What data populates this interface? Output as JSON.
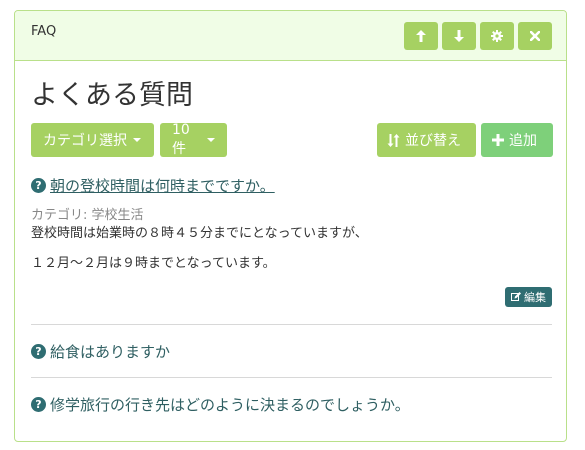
{
  "panel": {
    "title": "FAQ",
    "buttons": [
      {
        "icon": "arrow-up-icon"
      },
      {
        "icon": "arrow-down-icon"
      },
      {
        "icon": "gear-icon"
      },
      {
        "icon": "close-icon"
      }
    ]
  },
  "page_title": "よくある質問",
  "toolbar": {
    "category_select_label": "カテゴリ選択",
    "per_page_label": "10件",
    "sort_label": "並び替え",
    "add_label": "追加"
  },
  "faqs": [
    {
      "question": "朝の登校時間は何時までですか。",
      "expanded": true,
      "category_label": "カテゴリ: 学校生活",
      "answer_line1": "登校時間は始業時の８時４５分までにとなっていますが、",
      "answer_line2": "１２月～２月は９時までとなっています。",
      "edit_label": "編集"
    },
    {
      "question": "給食はありますか",
      "expanded": false
    },
    {
      "question": "修学旅行の行き先はどのように決まるのでしょうか。",
      "expanded": false
    }
  ],
  "colors": {
    "accent_green": "#a6d162",
    "add_green": "#7ed07a",
    "teal": "#2f6d72",
    "panel_border": "#b9e08a",
    "panel_head_bg": "#f0fde6"
  }
}
